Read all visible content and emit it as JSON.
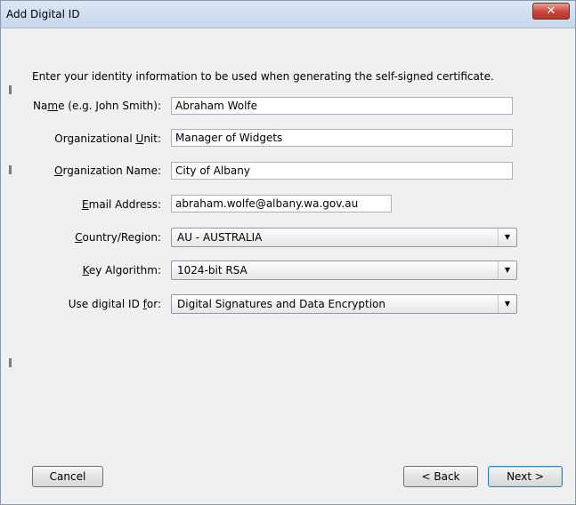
{
  "window": {
    "title": "Add Digital ID",
    "close_glyph": "✕"
  },
  "intro": "Enter your identity information to be used when generating the self-signed certificate.",
  "form": {
    "name": {
      "pre": "Na",
      "key": "m",
      "post": "e (e.g. John Smith):",
      "value": "Abraham Wolfe"
    },
    "org_unit": {
      "pre": "Organizational ",
      "key": "U",
      "post": "nit:",
      "value": "Manager of Widgets"
    },
    "org_name": {
      "pre": "",
      "key": "O",
      "post": "rganization Name:",
      "value": "City of Albany"
    },
    "email": {
      "pre": "",
      "key": "E",
      "post": "mail Address:",
      "value": "abraham.wolfe@albany.wa.gov.au"
    },
    "country": {
      "pre": "",
      "key": "C",
      "post": "ountry/Region:",
      "value": "AU - AUSTRALIA"
    },
    "key_algorithm": {
      "pre": "",
      "key": "K",
      "post": "ey Algorithm:",
      "value": "1024-bit RSA"
    },
    "use_for": {
      "pre": "Use digital ID ",
      "key": "f",
      "post": "or:",
      "value": "Digital Signatures and Data Encryption"
    }
  },
  "buttons": {
    "cancel": "Cancel",
    "back": "< Back",
    "next": "Next >"
  },
  "icons": {
    "dropdown": "chevron-down-icon",
    "close": "close-icon"
  }
}
